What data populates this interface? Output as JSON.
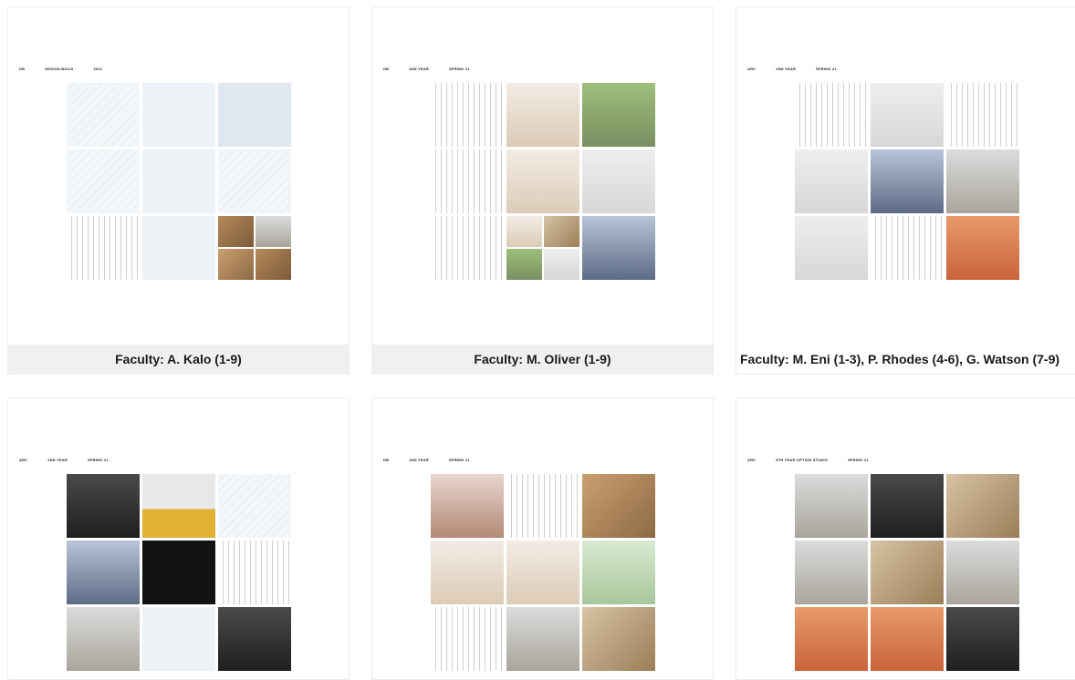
{
  "cards": [
    {
      "tags": [
        "DB",
        "DESIGN-BUILD",
        "2021"
      ],
      "caption": "Faculty: A. Kalo (1-9)"
    },
    {
      "tags": [
        "DB",
        "2ND YEAR",
        "SPRING 21"
      ],
      "caption": "Faculty: M. Oliver (1-9)"
    },
    {
      "tags": [
        "ARC",
        "2ND YEAR",
        "SPRING 21"
      ],
      "caption": "Faculty: M. Eni (1-3), P. Rhodes (4-6), G. Watson (7-9)"
    },
    {
      "tags": [
        "ARC",
        "2ND YEAR",
        "SPRING 21"
      ],
      "caption": ""
    },
    {
      "tags": [
        "DB",
        "2ND YEAR",
        "SPRING 21"
      ],
      "caption": ""
    },
    {
      "tags": [
        "ARC",
        "5TH YEAR OPTION STUDIO",
        "SPRING 21"
      ],
      "caption": ""
    }
  ]
}
